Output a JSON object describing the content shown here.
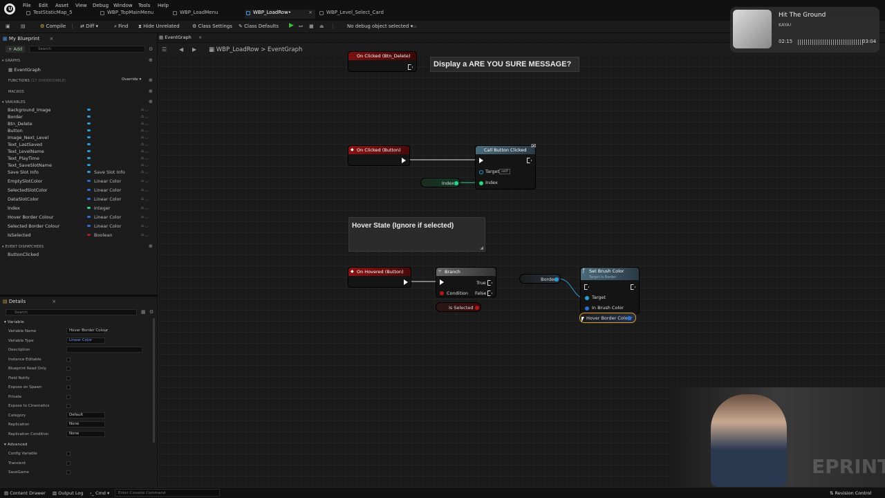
{
  "app": {
    "logo": "unreal-engine-logo",
    "menu": [
      "File",
      "Edit",
      "Asset",
      "View",
      "Debug",
      "Window",
      "Tools",
      "Help"
    ],
    "doc_tabs": [
      {
        "label": "TestStaticMap_5",
        "active": false
      },
      {
        "label": "WBP_TopMainMenu",
        "active": false
      },
      {
        "label": "WBP_LoadMenu",
        "active": false
      },
      {
        "label": "WBP_LoadRow•",
        "active": true
      },
      {
        "label": "WBP_Level_Select_Card",
        "active": false
      }
    ]
  },
  "toolbar": {
    "compile": "Compile",
    "diff": "Diff",
    "find": "Find",
    "hide_unrelated": "Hide Unrelated",
    "class_settings": "Class Settings",
    "class_defaults": "Class Defaults",
    "debug_object": "No debug object selected"
  },
  "my_blueprint": {
    "tab": "My Blueprint",
    "add": "+ Add",
    "search_placeholder": "Search",
    "graphs_head": "GRAPHS",
    "event_graph": "EventGraph",
    "functions_head": "FUNCTIONS",
    "functions_sub": "(17 OVERRIDABLE)",
    "override": "Override",
    "macros_head": "MACROS",
    "variables_head": "VARIABLES",
    "variables": [
      {
        "name": "Background_Image",
        "type": "",
        "color": "#2a9bd6"
      },
      {
        "name": "Border",
        "type": "",
        "color": "#2a9bd6"
      },
      {
        "name": "Btn_Delete",
        "type": "",
        "color": "#2a9bd6"
      },
      {
        "name": "Button",
        "type": "",
        "color": "#2a9bd6"
      },
      {
        "name": "Image_Next_Level",
        "type": "",
        "color": "#2a9bd6"
      },
      {
        "name": "Text_LastSaved",
        "type": "",
        "color": "#2a9bd6"
      },
      {
        "name": "Text_LevelName",
        "type": "",
        "color": "#2a9bd6"
      },
      {
        "name": "Text_PlayTime",
        "type": "",
        "color": "#2a9bd6"
      },
      {
        "name": "Text_SaveSlotName",
        "type": "",
        "color": "#2a9bd6"
      },
      {
        "name": "Save Slot Info",
        "type": "Save Slot Info",
        "color": "#2a9bd6"
      },
      {
        "name": "EmptySlotColor",
        "type": "Linear Color",
        "color": "#2a6fd6"
      },
      {
        "name": "SelectedSlotColor",
        "type": "Linear Color",
        "color": "#2a6fd6"
      },
      {
        "name": "DataSlotColor",
        "type": "Linear Color",
        "color": "#2a6fd6"
      },
      {
        "name": "Index",
        "type": "Integer",
        "color": "#28d490"
      },
      {
        "name": "Hover Border Colour",
        "type": "Linear Color",
        "color": "#2a6fd6"
      },
      {
        "name": "Selected Border Colour",
        "type": "Linear Color",
        "color": "#2a6fd6"
      },
      {
        "name": "IsSelected",
        "type": "Boolean",
        "color": "#b01818"
      }
    ],
    "dispatchers_head": "EVENT DISPATCHERS",
    "dispatchers": [
      "ButtonClicked"
    ]
  },
  "details": {
    "tab": "Details",
    "search_placeholder": "Search",
    "section": "Variable",
    "rows": [
      {
        "label": "Variable Name",
        "value": "Hover Border Colour",
        "kind": "text"
      },
      {
        "label": "Variable Type",
        "value": "Linear Color",
        "kind": "type"
      },
      {
        "label": "Description",
        "value": "",
        "kind": "text-wide"
      },
      {
        "label": "Instance Editable",
        "value": "",
        "kind": "check"
      },
      {
        "label": "Blueprint Read Only",
        "value": "",
        "kind": "check"
      },
      {
        "label": "Field Notify",
        "value": "",
        "kind": "check"
      },
      {
        "label": "Expose on Spawn",
        "value": "",
        "kind": "check"
      },
      {
        "label": "Private",
        "value": "",
        "kind": "check"
      },
      {
        "label": "Expose to Cinematics",
        "value": "",
        "kind": "check"
      },
      {
        "label": "Category",
        "value": "Default",
        "kind": "select"
      },
      {
        "label": "Replication",
        "value": "None",
        "kind": "select"
      },
      {
        "label": "Replication Condition",
        "value": "None",
        "kind": "select"
      }
    ],
    "advanced": "Advanced",
    "advanced_rows": [
      "Config Variable",
      "Transient",
      "SaveGame"
    ]
  },
  "graph_tab": {
    "label": "EventGraph",
    "breadcrumb_root": "WBP_LoadRow",
    "breadcrumb_sep": ">",
    "breadcrumb_leaf": "EventGraph"
  },
  "graph": {
    "comment1": "Display a ARE YOU SURE MESSAGE?",
    "comment2": "Hover State (Ignore if selected)",
    "node_btn_delete": "On Clicked (Btn_Delete)",
    "node_on_clicked": "On Clicked (Button)",
    "node_call": "Call Button Clicked",
    "call_target": "Target",
    "call_target_val": "self",
    "call_index": "Index",
    "var_index": "Index",
    "node_on_hovered": "On Hovered (Button)",
    "node_branch": "Branch",
    "branch_condition": "Condition",
    "branch_true": "True",
    "branch_false": "False",
    "var_is_selected": "Is Selected",
    "var_border": "Border",
    "node_set_brush": "Set Brush Color",
    "set_brush_sub": "Target is Border",
    "set_target": "Target",
    "set_in_brush": "In Brush Color",
    "var_hover_border": "Hover Border Colour"
  },
  "status": {
    "content_drawer": "Content Drawer",
    "output_log": "Output Log",
    "cmd": "Cmd",
    "console_placeholder": "Enter Console Command",
    "revision_control": "Revision Control"
  },
  "music": {
    "title": "Hit The Ground",
    "artist": "KAYA!",
    "elapsed": "02:15",
    "total": "03:04"
  },
  "watermark": "EPRINT"
}
